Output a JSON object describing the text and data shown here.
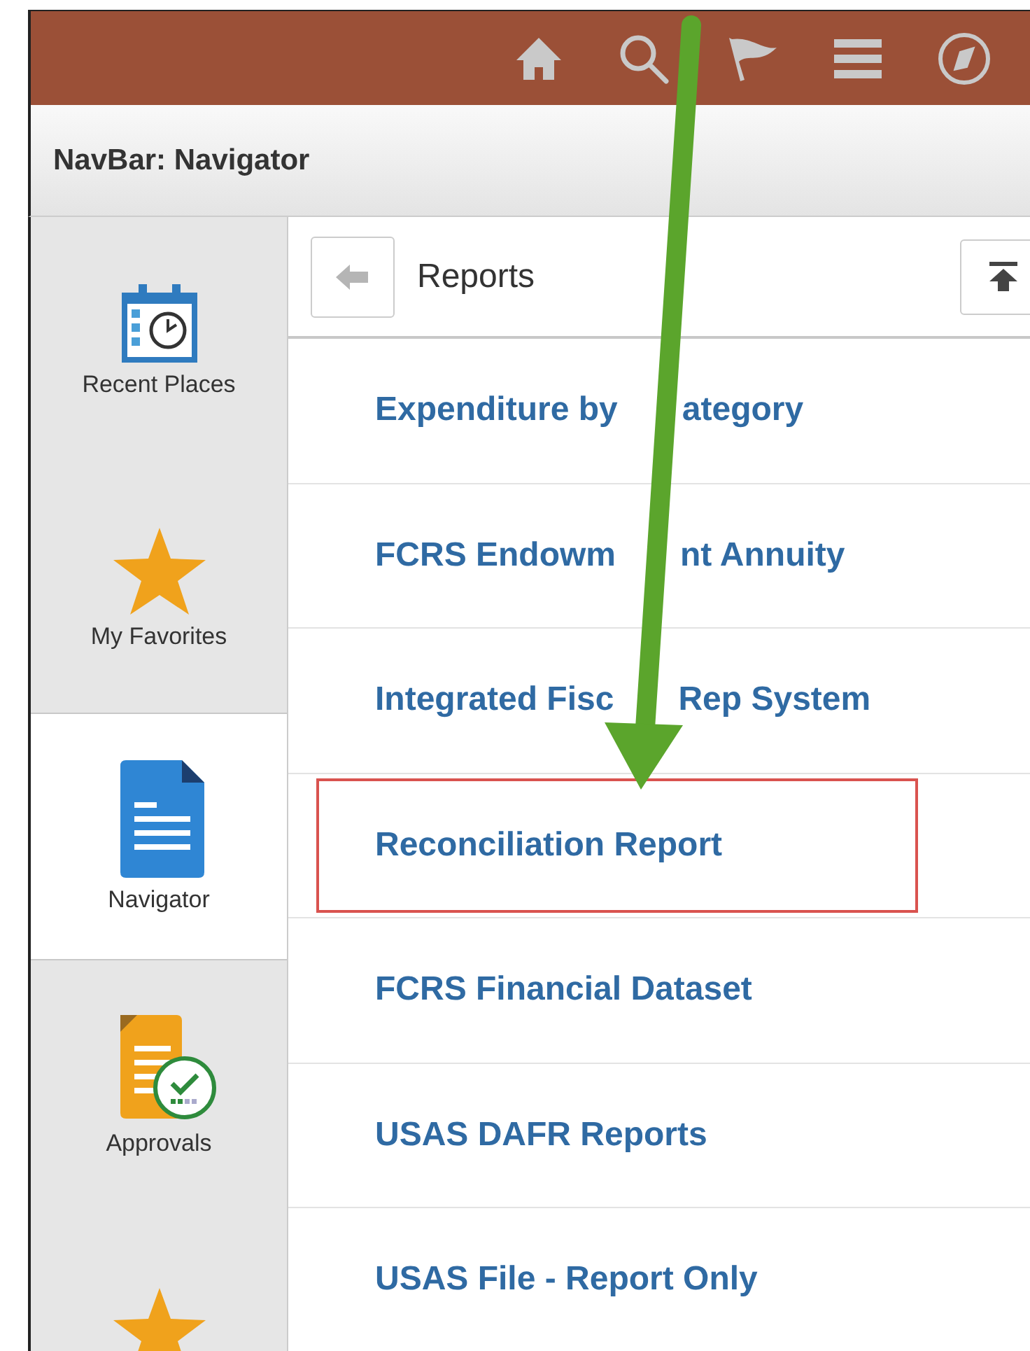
{
  "top_bar": {
    "icons": [
      {
        "kind": "home"
      },
      {
        "kind": "search"
      },
      {
        "kind": "flag"
      },
      {
        "kind": "menu"
      },
      {
        "kind": "compass"
      }
    ]
  },
  "title_bar": {
    "title": "NavBar: Navigator"
  },
  "sidebar": {
    "items": [
      {
        "kind": "recent",
        "label": "Recent Places",
        "selected": false
      },
      {
        "kind": "favorites",
        "label": "My Favorites",
        "selected": false
      },
      {
        "kind": "navigator",
        "label": "Navigator",
        "selected": true
      },
      {
        "kind": "approvals",
        "label": "Approvals",
        "selected": false
      },
      {
        "kind": "favorites",
        "selected": false
      }
    ]
  },
  "content": {
    "heading": "Reports",
    "items": [
      {
        "label_parts": [
          "Expenditure by",
          "ategory"
        ],
        "highlighted": false
      },
      {
        "label_parts": [
          "FCRS Endowm",
          "nt Annuity"
        ],
        "highlighted": false
      },
      {
        "label_parts": [
          "Integrated Fisc",
          "Rep System"
        ],
        "highlighted": false
      },
      {
        "label": "Reconciliation Report",
        "highlighted": true
      },
      {
        "label": "FCRS Financial Dataset",
        "highlighted": false
      },
      {
        "label": "USAS DAFR Reports",
        "highlighted": false
      },
      {
        "label": "USAS File - Report Only",
        "highlighted": false
      }
    ]
  },
  "annotation": {
    "arrow": true
  }
}
